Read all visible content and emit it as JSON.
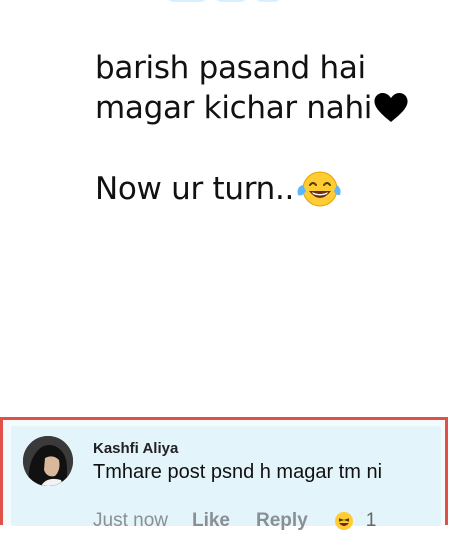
{
  "post": {
    "line1": "barish pasand hai",
    "line2": "magar kichar nahi",
    "line3": "Now ur turn..",
    "heart_icon": "black-heart",
    "laugh_icon": "face-with-tears-of-joy"
  },
  "comment": {
    "author": "Kashfi Aliya",
    "text": "Tmhare post psnd h magar tm ni",
    "timestamp": "Just now",
    "like_label": "Like",
    "reply_label": "Reply",
    "reaction_icon": "laughing-face",
    "reaction_count": "1"
  },
  "colors": {
    "highlight_border": "#e0514a",
    "comment_background": "#e3f5fb",
    "action_text": "#8a8f93"
  }
}
